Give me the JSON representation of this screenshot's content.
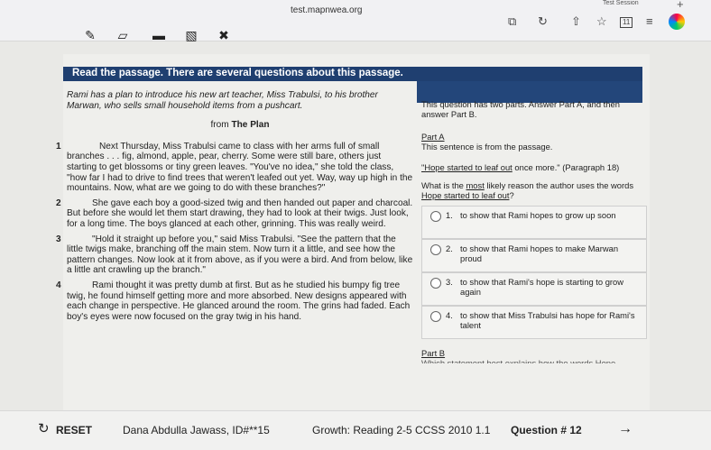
{
  "browser": {
    "url": "test.mapnwea.org",
    "session": "Test Session",
    "plus": "+",
    "icons": {
      "reader": "⧉",
      "reload": "↻",
      "share": "⇧",
      "star": "☆",
      "tabs": "11",
      "menu": "≡"
    }
  },
  "toolbar": {
    "pencil": "✎",
    "eraser": "▱",
    "highlighter": "▬",
    "book": "▧",
    "cross": "✖"
  },
  "banner": "Read the passage. There are several questions about this passage.",
  "passage": {
    "intro": "Rami has a plan to introduce his new art teacher, Miss Trabulsi, to his brother Marwan, who sells small household items from a pushcart.",
    "from_prefix": "from ",
    "from_title": "The Plan",
    "paragraphs": [
      {
        "num": "1",
        "text": "Next Thursday, Miss Trabulsi came to class with her arms full of small branches . . . fig, almond, apple, pear, cherry. Some were still bare, others just starting to get blossoms or tiny green leaves. \"You've no idea,\" she told the class, \"how far I had to drive to find trees that weren't leafed out yet. Way, way up high in the mountains. Now, what are we going to do with these branches?\""
      },
      {
        "num": "2",
        "text": "She gave each boy a good-sized twig and then handed out paper and charcoal. But before she would let them start drawing, they had to look at their twigs. Just look, for a long time. The boys glanced at each other, grinning. This was really weird."
      },
      {
        "num": "3",
        "text": "\"Hold it straight up before you,\" said Miss Trabulsi. \"See the pattern that the little twigs make, branching off the main stem. Now turn it a little, and see how the pattern changes. Now look at it from above, as if you were a bird. And from below, like a little ant crawling up the branch.\""
      },
      {
        "num": "4",
        "text": "Rami thought it was pretty dumb at first. But as he studied his bumpy fig tree twig, he found himself getting more and more absorbed. New designs appeared with each change in perspective. He glanced around the room. The grins had faded. Each boy's eyes were now focused on the gray twig in his hand."
      }
    ]
  },
  "question": {
    "instructions": "This question has two parts. Answer Part A, and then answer Part B.",
    "part_a_label": "Part A",
    "sentence_intro": "This sentence is from the passage.",
    "quote_start": "\"Hope started to leaf out",
    "quote_end": " once more.\" (Paragraph 18)",
    "prompt_start": "What is the ",
    "prompt_most": "most",
    "prompt_mid": " likely reason the author uses the words ",
    "prompt_words": "Hope started to leaf out",
    "prompt_end": "?",
    "options": [
      {
        "num": "1.",
        "text": "to show that Rami hopes to grow up soon"
      },
      {
        "num": "2.",
        "text": "to show that Rami hopes to make Marwan proud"
      },
      {
        "num": "3.",
        "text": "to show that Rami's hope is starting to grow again"
      },
      {
        "num": "4.",
        "text": "to show that Miss Trabulsi has hope for Rami's talent"
      }
    ],
    "part_b_label": "Part B",
    "part_b_text": "Which statement best explains how the words Hope"
  },
  "footer": {
    "reset": "RESET",
    "reset_icon": "↻",
    "student": "Dana Abdulla Jawass, ID#**15",
    "growth": "Growth: Reading 2-5 CCSS 2010 1.1",
    "question_num": "Question # 12",
    "next_icon": "→"
  }
}
